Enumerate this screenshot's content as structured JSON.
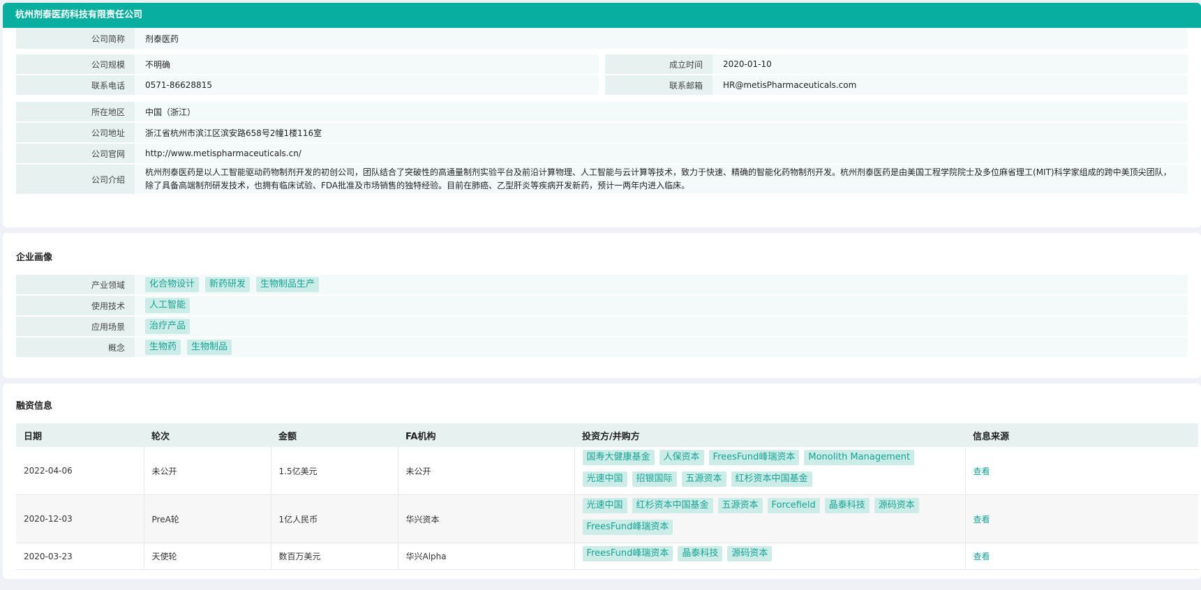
{
  "company": {
    "title": "杭州剂泰医药科技有限责任公司",
    "short_name_label": "公司简称",
    "short_name": "剂泰医药",
    "scale_label": "公司规模",
    "scale": "不明确",
    "founded_label": "成立时间",
    "founded": "2020-01-10",
    "phone_label": "联系电话",
    "phone": "0571-86628815",
    "email_label": "联系邮箱",
    "email": "HR@metisPharmaceuticals.com",
    "region_label": "所在地区",
    "region": "中国（浙江）",
    "address_label": "公司地址",
    "address": "浙江省杭州市滨江区滨安路658号2幢1楼116室",
    "website_label": "公司官网",
    "website": "http://www.metispharmaceuticals.cn/",
    "intro_label": "公司介绍",
    "intro": "杭州剂泰医药是以人工智能驱动药物制剂开发的初创公司，团队结合了突破性的高通量制剂实验平台及前沿计算物理、人工智能与云计算等技术，致力于快速、精确的智能化药物制剂开发。杭州剂泰医药是由美国工程学院院士及多位麻省理工(MIT)科学家组成的跨中美顶尖团队，除了具备高端制剂研发技术，也拥有临床试验、FDA批准及市场销售的独特经验。目前在肺癌、乙型肝炎等疾病开发新药，预计一两年内进入临床。"
  },
  "profile": {
    "title": "企业画像",
    "rows": [
      {
        "label": "产业领域",
        "tags": [
          "化合物设计",
          "新药研发",
          "生物制品生产"
        ]
      },
      {
        "label": "使用技术",
        "tags": [
          "人工智能"
        ]
      },
      {
        "label": "应用场景",
        "tags": [
          "治疗产品"
        ]
      },
      {
        "label": "概念",
        "tags": [
          "生物药",
          "生物制品"
        ]
      }
    ]
  },
  "financing": {
    "title": "融资信息",
    "columns": [
      "日期",
      "轮次",
      "金额",
      "FA机构",
      "投资方/并购方",
      "信息来源"
    ],
    "rows": [
      {
        "date": "2022-04-06",
        "round": "未公开",
        "amount": "1.5亿美元",
        "fa": "未公开",
        "investors": [
          "国寿大健康基金",
          "人保资本",
          "FreesFund峰瑞资本",
          "Monolith Management",
          "光速中国",
          "招银国际",
          "五源资本",
          "红杉资本中国基金"
        ],
        "source": "查看"
      },
      {
        "date": "2020-12-03",
        "round": "PreA轮",
        "amount": "1亿人民币",
        "fa": "华兴资本",
        "investors": [
          "光速中国",
          "红杉资本中国基金",
          "五源资本",
          "Forcefield",
          "晶泰科技",
          "源码资本",
          "FreesFund峰瑞资本"
        ],
        "source": "查看"
      },
      {
        "date": "2020-03-23",
        "round": "天使轮",
        "amount": "数百万美元",
        "fa": "华兴Alpha",
        "investors": [
          "FreesFund峰瑞资本",
          "晶泰科技",
          "源码资本"
        ],
        "source": "查看"
      }
    ]
  },
  "colors": {
    "accent": "#08ae9e",
    "tag_bg": "#ccece8",
    "tag_text": "#17a394"
  }
}
